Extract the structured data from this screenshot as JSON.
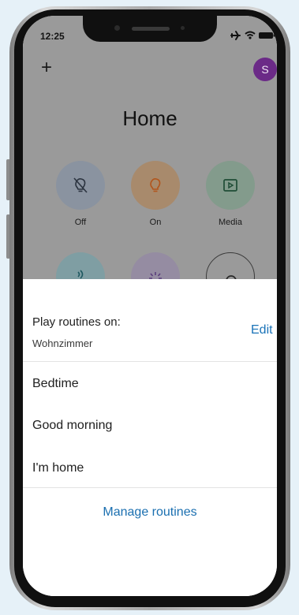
{
  "status_bar": {
    "time": "12:25"
  },
  "header": {
    "add_label": "+",
    "avatar_initial": "S",
    "avatar_color": "#6b2a87"
  },
  "title": "Home",
  "tiles": [
    {
      "label": "Off",
      "icon": "lightbulb-off-icon"
    },
    {
      "label": "On",
      "icon": "lightbulb-icon"
    },
    {
      "label": "Media",
      "icon": "play-screen-icon"
    }
  ],
  "sheet": {
    "title": "Play routines on:",
    "device": "Wohnzimmer",
    "edit_label": "Edit",
    "routines": [
      "Bedtime",
      "Good morning",
      "I'm home"
    ],
    "manage_label": "Manage routines",
    "accent_color": "#1a73b8"
  }
}
